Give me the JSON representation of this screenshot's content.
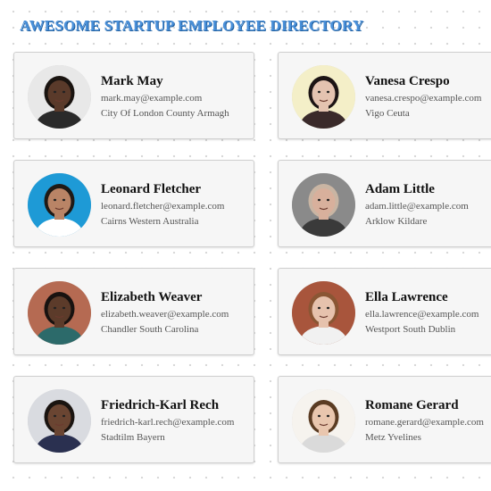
{
  "header": {
    "title": "AWESOME STARTUP EMPLOYEE DIRECTORY"
  },
  "employees": [
    {
      "name": "Mark May",
      "email": "mark.may@example.com",
      "location": "City Of London County Armagh",
      "skin": "#5a3a2a",
      "hair": "#1a1410",
      "bg": "#e8e8e8",
      "shirt": "#2a2a2a"
    },
    {
      "name": "Vanesa Crespo",
      "email": "vanesa.crespo@example.com",
      "location": "Vigo Ceuta",
      "skin": "#e4c3b0",
      "hair": "#1c1414",
      "bg": "#f4efc8",
      "shirt": "#3a2a2a"
    },
    {
      "name": "Leonard Fletcher",
      "email": "leonard.fletcher@example.com",
      "location": "Cairns Western Australia",
      "skin": "#b98466",
      "hair": "#1f1a16",
      "bg": "#1e9ad6",
      "shirt": "#ffffff"
    },
    {
      "name": "Adam Little",
      "email": "adam.little@example.com",
      "location": "Arklow Kildare",
      "skin": "#d8b09c",
      "hair": "#c9b5a3",
      "bg": "#8a8a8a",
      "shirt": "#3a3a3a"
    },
    {
      "name": "Elizabeth Weaver",
      "email": "elizabeth.weaver@example.com",
      "location": "Chandler South Carolina",
      "skin": "#5c3b2a",
      "hair": "#181210",
      "bg": "#b56a52",
      "shirt": "#2c6a6a"
    },
    {
      "name": "Ella Lawrence",
      "email": "ella.lawrence@example.com",
      "location": "Westport South Dublin",
      "skin": "#e6c2ad",
      "hair": "#8a5634",
      "bg": "#a8553c",
      "shirt": "#f1f1f1"
    },
    {
      "name": "Friedrich-Karl Rech",
      "email": "friedrich-karl.rech@example.com",
      "location": "Stadtilm Bayern",
      "skin": "#6a4532",
      "hair": "#1a1410",
      "bg": "#d9dbe0",
      "shirt": "#2a3050"
    },
    {
      "name": "Romane Gerard",
      "email": "romane.gerard@example.com",
      "location": "Metz Yvelines",
      "skin": "#e9c6ae",
      "hair": "#5a3b22",
      "bg": "#f6f3ee",
      "shirt": "#dadada"
    }
  ]
}
